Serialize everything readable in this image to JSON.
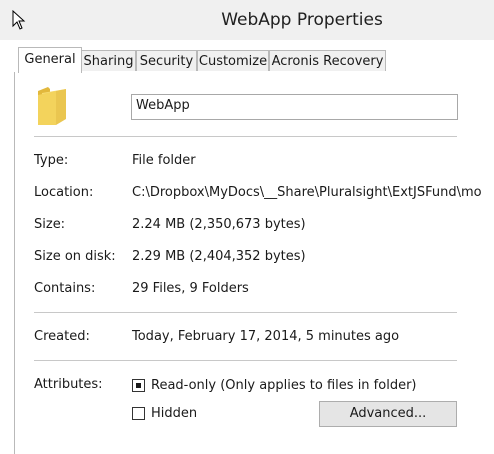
{
  "window": {
    "title": "WebApp Properties"
  },
  "tabs": [
    {
      "label": "General"
    },
    {
      "label": "Sharing"
    },
    {
      "label": "Security"
    },
    {
      "label": "Customize"
    },
    {
      "label": "Acronis Recovery"
    }
  ],
  "general": {
    "name_value": "WebApp",
    "type_label": "Type:",
    "type_value": "File folder",
    "location_label": "Location:",
    "location_value": "C:\\Dropbox\\MyDocs\\__Share\\Pluralsight\\ExtJSFund\\mo",
    "size_label": "Size:",
    "size_value": "2.24 MB (2,350,673 bytes)",
    "size_on_disk_label": "Size on disk:",
    "size_on_disk_value": "2.29 MB (2,404,352 bytes)",
    "contains_label": "Contains:",
    "contains_value": "29 Files, 9 Folders",
    "created_label": "Created:",
    "created_value": "Today, February 17, 2014, 5 minutes ago",
    "attributes_label": "Attributes:",
    "readonly_label": "Read-only (Only applies to files in folder)",
    "readonly_state": "indeterminate",
    "hidden_label": "Hidden",
    "hidden_state": "unchecked",
    "advanced_button": "Advanced..."
  },
  "icons": {
    "cursor": "mouse-pointer-icon",
    "folder": "folder-icon"
  },
  "colors": {
    "folder_yellow": "#f3d35c",
    "window_bg": "#f0f0f0",
    "panel_bg": "#ffffff"
  }
}
